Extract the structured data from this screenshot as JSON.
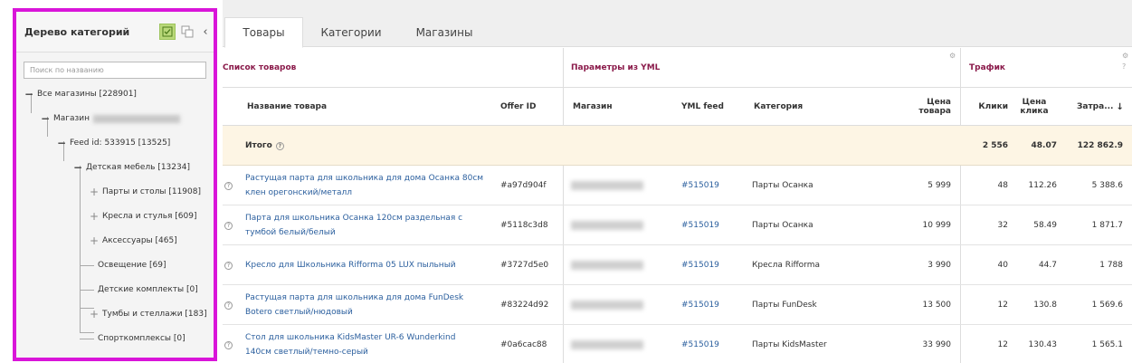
{
  "sidebar": {
    "title": "Дерево категорий",
    "search_placeholder": "Поиск по названию",
    "tree": {
      "all_stores": "Все магазины [228901]",
      "store": "Магазин",
      "feed": "Feed id: 533915 [13525]",
      "kids_furniture": "Детская мебель [13234]",
      "desks_tables": "Парты и столы [11908]",
      "chairs": "Кресла и стулья [609]",
      "accessories": "Аксессуары [465]",
      "lighting": "Освещение [69]",
      "kids_sets": "Детские комплекты [0]",
      "cabinets": "Тумбы и стеллажи [183]",
      "sport": "Спорткомплексы [0]"
    }
  },
  "tabs": [
    "Товары",
    "Категории",
    "Магазины"
  ],
  "sections": {
    "products": "Список товаров",
    "yml": "Параметры из YML",
    "traffic": "Трафик"
  },
  "columns": {
    "name": "Название товара",
    "offer_id": "Offer ID",
    "store": "Магазин",
    "yml_feed": "YML feed",
    "category": "Категория",
    "price_1": "Цена",
    "price_2": "товара",
    "clicks": "Клики",
    "click_price_1": "Цена",
    "click_price_2": "клика",
    "cost": "Затра..."
  },
  "total": {
    "label": "Итого",
    "clicks": "2 556",
    "click_price": "48.07",
    "cost": "122 862.9"
  },
  "rows": [
    {
      "name_1": "Растущая парта для школьника для дома Осанка 80см",
      "name_2": "клен орегонский/металл",
      "offer_id": "#a97d904f",
      "feed": "#515019",
      "category": "Парты Осанка",
      "price": "5 999",
      "clicks": "48",
      "click_price": "112.26",
      "cost": "5 388.6"
    },
    {
      "name_1": "Парта для школьника Осанка 120см раздельная с",
      "name_2": "тумбой белый/белый",
      "offer_id": "#5118c3d8",
      "feed": "#515019",
      "category": "Парты Осанка",
      "price": "10 999",
      "clicks": "32",
      "click_price": "58.49",
      "cost": "1 871.7"
    },
    {
      "name_1": "Кресло для Школьника Rifforma 05 LUX пыльный",
      "name_2": "",
      "offer_id": "#3727d5e0",
      "feed": "#515019",
      "category": "Кресла Rifforma",
      "price": "3 990",
      "clicks": "40",
      "click_price": "44.7",
      "cost": "1 788"
    },
    {
      "name_1": "Растущая парта для школьника для дома FunDesk",
      "name_2": "Botero светлый/нюдовый",
      "offer_id": "#83224d92",
      "feed": "#515019",
      "category": "Парты FunDesk",
      "price": "13 500",
      "clicks": "12",
      "click_price": "130.8",
      "cost": "1 569.6"
    },
    {
      "name_1": "Стол для школьника KidsMaster UR-6 Wunderkind",
      "name_2": "140см светлый/темно-серый",
      "offer_id": "#0a6cac88",
      "feed": "#515019",
      "category": "Парты KidsMaster",
      "price": "33 990",
      "clicks": "12",
      "click_price": "130.43",
      "cost": "1 565.1"
    }
  ],
  "icons": {
    "check": "check-square-icon",
    "copy": "copy-icon",
    "collapse": "chevron-left-icon",
    "help": "question-circle-icon",
    "gear": "gear-icon"
  },
  "colors": {
    "highlight_border": "#d915d9",
    "section_title": "#8a1a4a",
    "link": "#2b5f9e",
    "total_bg": "#fdf5e4"
  }
}
